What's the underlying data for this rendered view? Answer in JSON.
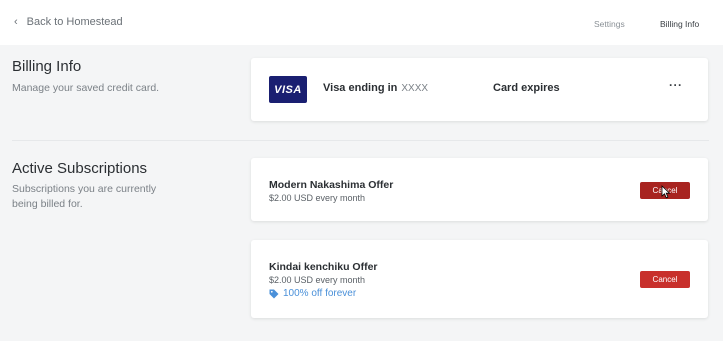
{
  "header": {
    "back_label": "Back to Homestead",
    "tabs": [
      {
        "label": "Settings",
        "active": false
      },
      {
        "label": "Billing Info",
        "active": true
      }
    ]
  },
  "billing_info": {
    "title": "Billing Info",
    "description": "Manage your saved credit card.",
    "card": {
      "brand_logo_text": "VISA",
      "ending_label": "Visa ending in",
      "ending_mask": "XXXX",
      "expires_label": "Card expires",
      "more_icon": "ellipsis-icon",
      "more_label": "···"
    }
  },
  "subscriptions": {
    "title": "Active Subscriptions",
    "description_line1": "Subscriptions you are currently",
    "description_line2": "being billed for.",
    "items": [
      {
        "name": "Modern Nakashima Offer",
        "price": "$2.00 USD every month",
        "cancel_label": "Cancel"
      },
      {
        "name": "Kindai kenchiku Offer",
        "price": "$2.00 USD every month",
        "discount": "100% off forever",
        "discount_icon": "tag-icon",
        "cancel_label": "Cancel"
      }
    ]
  },
  "colors": {
    "background": "#f4f5f6",
    "card": "#ffffff",
    "visa_blue": "#1a1f71",
    "cancel_red": "#c8302c",
    "discount_blue": "#4a90d9"
  }
}
